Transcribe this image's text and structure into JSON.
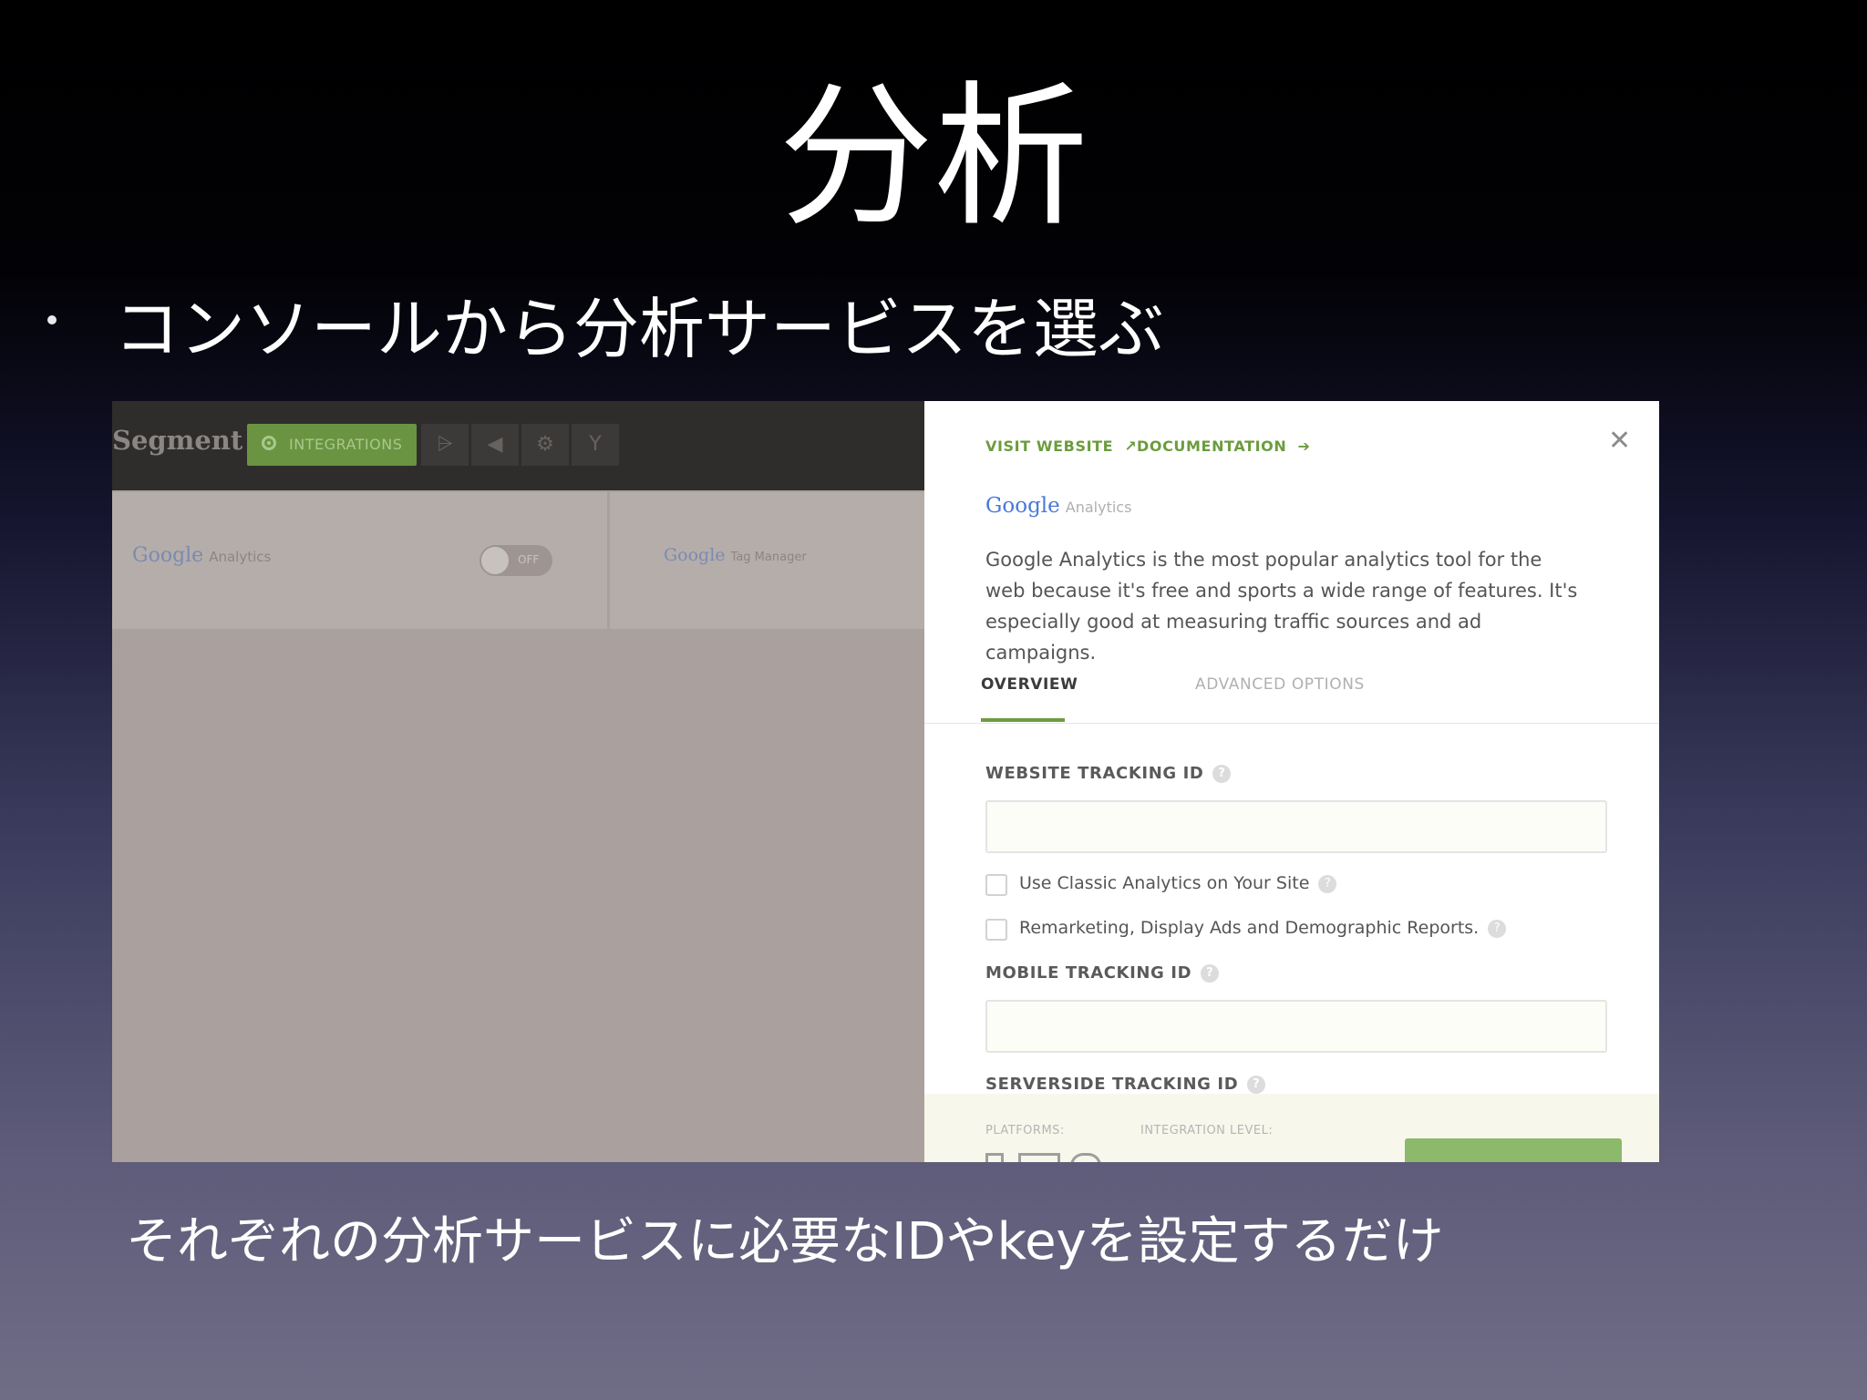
{
  "slide": {
    "title": "分析",
    "bullet": "コンソールから分析サービスを選ぶ",
    "caption": "それぞれの分析サービスに必要なIDやkeyを設定するだけ"
  },
  "app": {
    "brand": "Segment",
    "nav": {
      "integrations_label": "INTEGRATIONS",
      "icons": [
        "chart-icon",
        "megaphone-icon",
        "gear-icon",
        "debugger-icon"
      ]
    },
    "cards": [
      {
        "logo": "Google",
        "product": "Analytics",
        "toggle": "OFF"
      },
      {
        "logo": "Google",
        "product": "Tag Manager"
      }
    ]
  },
  "panel": {
    "visit_website": "VISIT WEBSITE",
    "documentation": "DOCUMENTATION",
    "logo": "Google",
    "product": "Analytics",
    "description": "Google Analytics is the most popular analytics tool for the web because it's free and sports a wide range of features. It's especially good at measuring traffic sources and ad campaigns.",
    "tabs": {
      "overview": "OVERVIEW",
      "advanced": "ADVANCED OPTIONS"
    },
    "fields": {
      "website_tracking_id": {
        "label": "WEBSITE TRACKING ID",
        "value": ""
      },
      "classic_analytics": {
        "label": "Use Classic Analytics on Your Site",
        "checked": false
      },
      "remarketing": {
        "label": "Remarketing, Display Ads and Demographic Reports.",
        "checked": false
      },
      "mobile_tracking_id": {
        "label": "MOBILE TRACKING ID",
        "value": ""
      },
      "serverside_tracking_id": {
        "label": "SERVERSIDE TRACKING ID"
      }
    },
    "footer": {
      "platforms_label": "PLATFORMS:",
      "integration_level_label": "INTEGRATION LEVEL:"
    }
  },
  "colors": {
    "accent": "#6c9c3e",
    "nav_active": "#6a9441",
    "overlay": "#aaa19e"
  }
}
